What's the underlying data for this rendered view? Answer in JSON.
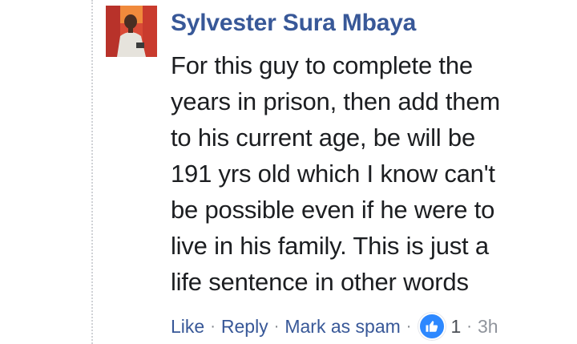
{
  "comment": {
    "author": "Sylvester Sura Mbaya",
    "text_lines": [
      "For this guy to complete the",
      "years in prison, then add them",
      "to his current age, be will be",
      "191 yrs old which I know can't",
      "be possible even if he were to",
      "live in his family. This is just a",
      "life sentence in other words"
    ],
    "actions": {
      "like": "Like",
      "reply": "Reply",
      "mark_spam": "Mark as spam",
      "separator": "·"
    },
    "reaction": {
      "icon": "thumbs-up-icon",
      "color": "#2d88ff",
      "count": "1"
    },
    "timestamp": "3h"
  },
  "colors": {
    "link": "#385898",
    "text": "#1c1e21",
    "meta": "#90949c"
  }
}
